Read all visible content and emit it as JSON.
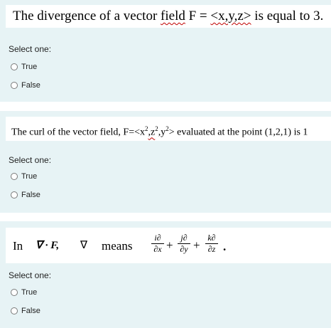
{
  "q1": {
    "text_pre": "The divergence of a vector ",
    "text_field": "field",
    "text_mid": " F = ",
    "text_vec": "<x,y,z>",
    "text_post": " is equal to  3.",
    "select_label": "Select one:",
    "options": [
      "True",
      "False"
    ]
  },
  "q2": {
    "text_pre": "The curl of the vector field, F=<x",
    "sup1": "2",
    "text_b": ",z",
    "sup2": "2",
    "text_c": ",y",
    "sup3": "2",
    "text_post": "> evaluated at the point (1,2,1) is 1",
    "select_label": "Select one:",
    "options": [
      "True",
      "False"
    ]
  },
  "q3": {
    "word_in": "In",
    "expr_div": "∇ · F,",
    "nabla": "∇",
    "word_means": "means",
    "frac1": {
      "num": "i∂",
      "den": "∂x"
    },
    "frac2": {
      "num": "j∂",
      "den": "∂y"
    },
    "frac3": {
      "num": "k∂",
      "den": "∂z"
    },
    "plus": "+",
    "period": ".",
    "select_label": "Select one:",
    "options": [
      "True",
      "False"
    ]
  }
}
